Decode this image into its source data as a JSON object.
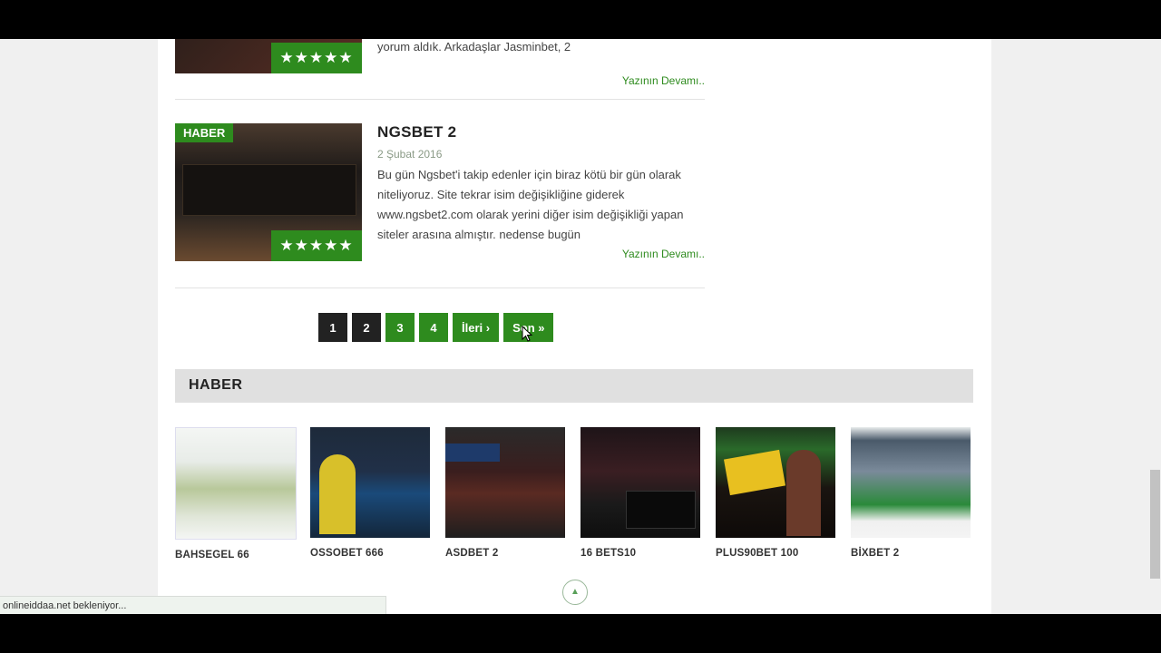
{
  "posts": [
    {
      "excerpt_tail": "yorum aldık. Arkadaşlar Jasminbet, 2",
      "more": "Yazının Devamı..",
      "stars": "★★★★★"
    },
    {
      "badge": "HABER",
      "title": "NGSBET 2",
      "date": "2 Şubat 2016",
      "excerpt": "Bu gün Ngsbet'i takip edenler için biraz kötü bir gün olarak niteliyoruz. Site tekrar isim değişikliğine giderek www.ngsbet2.com olarak yerini diğer isim değişikliği yapan siteler arasına almıştır. nedense bugün",
      "more": "Yazının Devamı..",
      "stars": "★★★★★"
    }
  ],
  "pagination": [
    "1",
    "2",
    "3",
    "4",
    "İleri ›",
    "Son »"
  ],
  "section": {
    "title": "HABER"
  },
  "cards": [
    {
      "title": "BAHSEGEL 66"
    },
    {
      "title": "OSSOBET 666"
    },
    {
      "title": "ASDBET 2"
    },
    {
      "title": "16 BETS10"
    },
    {
      "title": "PLUS90BET 100"
    },
    {
      "title": "BİXBET 2"
    }
  ],
  "status_text": "onlineiddaa.net bekleniyor...",
  "colors": {
    "accent": "#2e8b1e",
    "dark": "#222222"
  }
}
